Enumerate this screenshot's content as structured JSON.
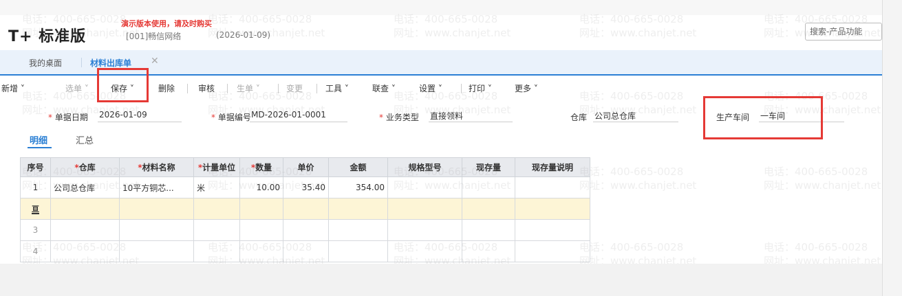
{
  "header": {
    "logo": "T+ 标准版",
    "demo_warning": "演示版本使用，请及时购买",
    "company": "[001]畅信网络",
    "date": "(2026-01-09)",
    "search_placeholder": "搜索-产品功能"
  },
  "tabs": [
    {
      "label": "我的桌面"
    },
    {
      "label": "材料出库单"
    }
  ],
  "toolbar": {
    "new": "新增",
    "select_doc": "选单",
    "save": "保存",
    "delete": "删除",
    "audit": "审核",
    "generate_doc": "生单",
    "change": "变更",
    "tools": "工具",
    "query": "联查",
    "settings": "设置",
    "print": "打印",
    "more": "更多"
  },
  "form": {
    "doc_date_label": "单据日期",
    "doc_date_value": "2026-01-09",
    "doc_no_label": "单据编号",
    "doc_no_value": "MD-2026-01-0001",
    "biz_type_label": "业务类型",
    "biz_type_value": "直接领料",
    "warehouse_label": "仓库",
    "warehouse_value": "公司总仓库",
    "workshop_label": "生产车间",
    "workshop_value": "一车间"
  },
  "subtabs": {
    "detail": "明细",
    "summary": "汇总"
  },
  "grid": {
    "headers": {
      "seq": "序号",
      "warehouse": "仓库",
      "material": "材料名称",
      "unit": "计量单位",
      "qty": "数量",
      "price": "单价",
      "amount": "金额",
      "spec": "规格型号",
      "stock": "现存量",
      "stock_note": "现存量说明"
    },
    "rows": [
      {
        "seq": "1",
        "warehouse": "公司总仓库",
        "material": "10平方铜芯...",
        "unit": "米",
        "qty": "10.00",
        "price": "35.40",
        "amount": "354.00"
      }
    ],
    "add_row_label": "亘",
    "empty_rows": [
      "3",
      "4"
    ]
  },
  "watermark": {
    "phone": "电话：400-665-0028",
    "site": "网址：www.chanjet.net"
  },
  "colors": {
    "accent": "#2a7fd4",
    "highlight": "#e53935",
    "selected_row": "#fdf5d6"
  }
}
